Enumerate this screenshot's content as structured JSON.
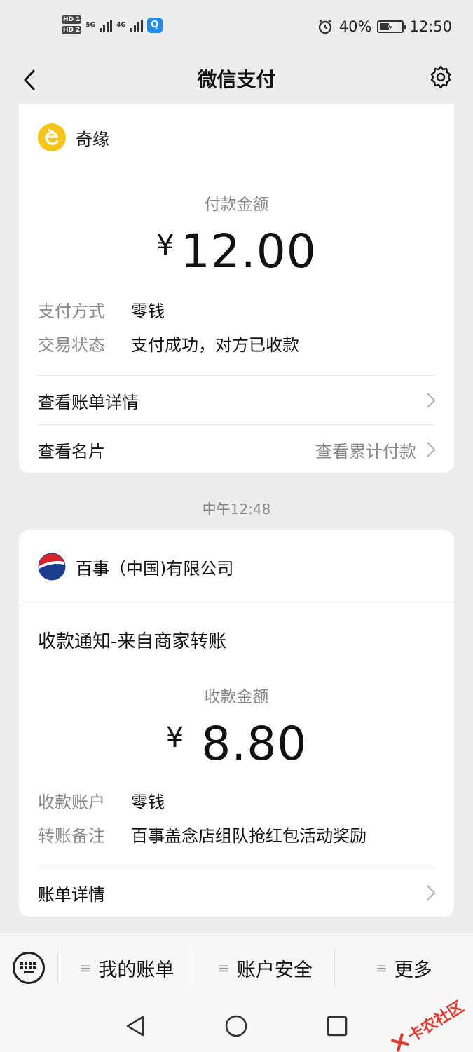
{
  "status_bar": {
    "hd1": "HD 1",
    "hd2": "HD 2",
    "net1": "5G",
    "net2": "4G",
    "app_icon": "Q",
    "battery": "40%",
    "time": "12:50"
  },
  "nav": {
    "title": "微信支付",
    "back_icon": "chevron-left-icon",
    "settings_icon": "gear-icon"
  },
  "payment_card": {
    "merchant": "奇缘",
    "amount_label": "付款金额",
    "currency": "¥",
    "amount": "12.00",
    "details": [
      {
        "key": "支付方式",
        "value": "零钱"
      },
      {
        "key": "交易状态",
        "value": "支付成功，对方已收款"
      }
    ],
    "bill_detail": "查看账单详情",
    "view_card": "查看名片",
    "view_total": "查看累计付款"
  },
  "time_separator": "中午12:48",
  "receive_card": {
    "merchant": "百事（中国)有限公司",
    "notify_title": "收款通知-来自商家转账",
    "amount_label": "收款金额",
    "currency": "¥",
    "amount": "8.80",
    "details": [
      {
        "key": "收款账户",
        "value": "零钱"
      },
      {
        "key": "转账备注",
        "value": "百事盖念店组队抢红包活动奖励"
      }
    ],
    "bill_detail": "账单详情"
  },
  "bottom_menu": {
    "items": [
      "我的账单",
      "账户安全",
      "更多"
    ]
  },
  "watermark": "卡农社区",
  "colors": {
    "background": "#ededed",
    "card": "#ffffff",
    "muted_text": "#888888",
    "qiyuan_logo": "#f5c518",
    "pepsi_blue": "#1b3b8c",
    "pepsi_red": "#d8232a",
    "watermark_red": "#e23a2e"
  }
}
